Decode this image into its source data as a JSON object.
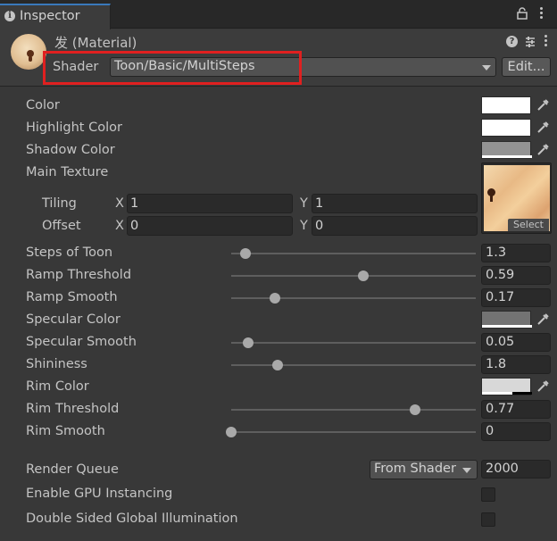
{
  "window": {
    "tab_label": "Inspector",
    "tab_icon": "info-icon"
  },
  "material": {
    "title": "发 (Material)",
    "shader_label": "Shader",
    "shader_value": "Toon/Basic/MultiSteps",
    "edit_label": "Edit..."
  },
  "props": {
    "color": {
      "label": "Color",
      "value": "#ffffff"
    },
    "highlight_color": {
      "label": "Highlight Color",
      "value": "#ffffff"
    },
    "shadow_color": {
      "label": "Shadow Color",
      "value": "#939393"
    },
    "main_texture": {
      "label": "Main Texture",
      "select_label": "Select",
      "tiling_label": "Tiling",
      "offset_label": "Offset",
      "x_label": "X",
      "y_label": "Y",
      "tiling_x": "1",
      "tiling_y": "1",
      "offset_x": "0",
      "offset_y": "0"
    },
    "steps_of_toon": {
      "label": "Steps of Toon",
      "value": "1.3",
      "fraction": 0.06
    },
    "ramp_threshold": {
      "label": "Ramp Threshold",
      "value": "0.59",
      "fraction": 0.54
    },
    "ramp_smooth": {
      "label": "Ramp Smooth",
      "value": "0.17",
      "fraction": 0.18
    },
    "specular_color": {
      "label": "Specular Color",
      "value": "#737373"
    },
    "specular_smooth": {
      "label": "Specular Smooth",
      "value": "0.05",
      "fraction": 0.07
    },
    "shininess": {
      "label": "Shininess",
      "value": "1.8",
      "fraction": 0.19
    },
    "rim_color": {
      "label": "Rim Color",
      "value": "#d8d8d8"
    },
    "rim_threshold": {
      "label": "Rim Threshold",
      "value": "0.77",
      "fraction": 0.75
    },
    "rim_smooth": {
      "label": "Rim Smooth",
      "value": "0",
      "fraction": 0.0
    }
  },
  "advanced": {
    "render_queue_label": "Render Queue",
    "render_queue_option": "From Shader",
    "render_queue_value": "2000",
    "gpu_instancing_label": "Enable GPU Instancing",
    "double_sided_gi_label": "Double Sided Global Illumination"
  },
  "colors": {
    "highlight_box": "#e02020",
    "tab_accent": "#3a79bb"
  }
}
